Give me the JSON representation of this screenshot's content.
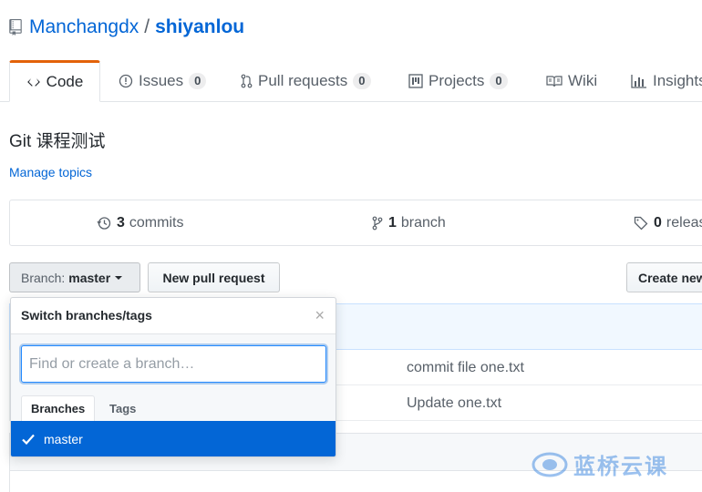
{
  "repo": {
    "owner": "Manchangdx",
    "separator": "/",
    "name": "shiyanlou"
  },
  "tabs": [
    {
      "label": "Code",
      "icon": "code-icon"
    },
    {
      "label": "Issues",
      "count": "0",
      "icon": "issue-icon"
    },
    {
      "label": "Pull requests",
      "count": "0",
      "icon": "pull-request-icon"
    },
    {
      "label": "Projects",
      "count": "0",
      "icon": "project-icon"
    },
    {
      "label": "Wiki",
      "icon": "book-icon"
    },
    {
      "label": "Insights",
      "icon": "graph-icon"
    }
  ],
  "description": "Git 课程测试",
  "manage_topics": "Manage topics",
  "summary": {
    "commits_count": "3",
    "commits_label": "commits",
    "branch_count": "1",
    "branch_label": "branch",
    "releases_count": "0",
    "releases_label": "releases"
  },
  "toolbar": {
    "branch_label": "Branch:",
    "branch_value": "master",
    "new_pull_request": "New pull request",
    "create_new_file": "Create new file"
  },
  "files": [
    {
      "message": "commit file one.txt"
    },
    {
      "message": "Update one.txt"
    }
  ],
  "branch_dropdown": {
    "title": "Switch branches/tags",
    "close": "×",
    "filter_placeholder": "Find or create a branch…",
    "tabs": [
      "Branches",
      "Tags"
    ],
    "items": [
      {
        "name": "master",
        "selected": true
      }
    ]
  },
  "watermark": "蓝桥云课",
  "colors": {
    "link": "#0366d6",
    "selected_tab_border": "#e36209",
    "selected_item": "#0366d6"
  }
}
